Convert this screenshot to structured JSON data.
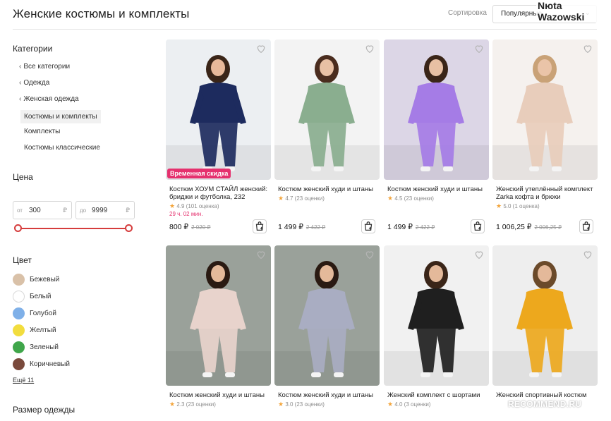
{
  "header": {
    "title": "Женские костюмы и комплекты",
    "sort_label": "Сортировка",
    "sort_value": "Популярные",
    "user_name": "Nюta Wazowski"
  },
  "sidebar": {
    "categories_title": "Категории",
    "categories": [
      {
        "label": "Все категории",
        "chevron": true
      },
      {
        "label": "Одежда",
        "chevron": true
      },
      {
        "label": "Женская одежда",
        "chevron": true
      },
      {
        "label": "Костюмы и комплекты",
        "chevron": false,
        "active": true
      },
      {
        "label": "Комплекты",
        "chevron": false
      },
      {
        "label": "Костюмы классические",
        "chevron": false
      }
    ],
    "price_title": "Цена",
    "price_from_prefix": "от",
    "price_from": "300",
    "price_to_prefix": "до",
    "price_to": "9999",
    "currency": "₽",
    "color_title": "Цвет",
    "colors": [
      {
        "label": "Бежевый",
        "hex": "#d9c1a8"
      },
      {
        "label": "Белый",
        "hex": "#ffffff"
      },
      {
        "label": "Голубой",
        "hex": "#7fb0e8"
      },
      {
        "label": "Желтый",
        "hex": "#f2dd3e"
      },
      {
        "label": "Зеленый",
        "hex": "#3fa64a"
      },
      {
        "label": "Коричневый",
        "hex": "#7a4a3c"
      }
    ],
    "more_link": "Ещё 11",
    "size_title": "Размер одежды"
  },
  "products": [
    {
      "name": "Костюм ХОУМ СТАЙЛ женский: бриджи и футболка, 232",
      "rating": "4.9",
      "reviews": "(101 оценка)",
      "promo": "Временная скидка",
      "timer": "29 ч. 02 мин.",
      "price": "800 ₽",
      "old_price": "2 020 ₽",
      "bg": "#eceff2",
      "body": "#1d2b5e",
      "skin": "#e8b99a",
      "hair": "#3a2518"
    },
    {
      "name": "Костюм женский худи и штаны",
      "rating": "4.7",
      "reviews": "(23 оценки)",
      "price": "1 499 ₽",
      "old_price": "2 422 ₽",
      "bg": "#f3f3f3",
      "body": "#8aae8f",
      "skin": "#e8c0a4",
      "hair": "#4a2c1e"
    },
    {
      "name": "Костюм женский худи и штаны",
      "rating": "4.5",
      "reviews": "(23 оценки)",
      "price": "1 499 ₽",
      "old_price": "2 422 ₽",
      "bg": "#dcd6e6",
      "body": "#a57ce6",
      "skin": "#e8c0a4",
      "hair": "#3a2518"
    },
    {
      "name": "Женский утеплённый комплект Zarka кофта и брюки",
      "rating": "5.0",
      "reviews": "(1 оценка)",
      "price": "1 006,25 ₽",
      "old_price": "2 006,25 ₽",
      "bg": "#f5f1ee",
      "body": "#e8cdbb",
      "skin": "#eac4a8",
      "hair": "#c9a277"
    },
    {
      "name": "Костюм женский худи и штаны",
      "rating": "2.3",
      "reviews": "(23 оценки)",
      "bg": "#9aa19a",
      "body": "#e8d3cc",
      "skin": "#e4b99a",
      "hair": "#2a1a12"
    },
    {
      "name": "Костюм женский худи и штаны",
      "rating": "3.0",
      "reviews": "(23 оценки)",
      "bg": "#9aa19a",
      "body": "#a9adc2",
      "skin": "#e4b99a",
      "hair": "#2a1a12"
    },
    {
      "name": "Женский комплект с шортами",
      "rating": "4.0",
      "reviews": "(3 оценки)",
      "bg": "#f1f1f1",
      "body": "#1f1f1f",
      "skin": "#e4b99a",
      "hair": "#3a2518"
    },
    {
      "name": "Женский спортивный костюм",
      "rating": "",
      "reviews": "",
      "bg": "#eeeeee",
      "body": "#eda81d",
      "skin": "#e4b99a",
      "hair": "#6b4a2a"
    }
  ],
  "icons": {
    "heart": "heart-icon",
    "cart": "cart-icon",
    "chevron": "chevron-left-icon",
    "sort": "chevron-down-icon"
  },
  "colors": {
    "accent": "#d53c3c",
    "promo": "#e5316e",
    "star": "#f3a43a"
  },
  "watermark": "RECOMMEND.RU"
}
